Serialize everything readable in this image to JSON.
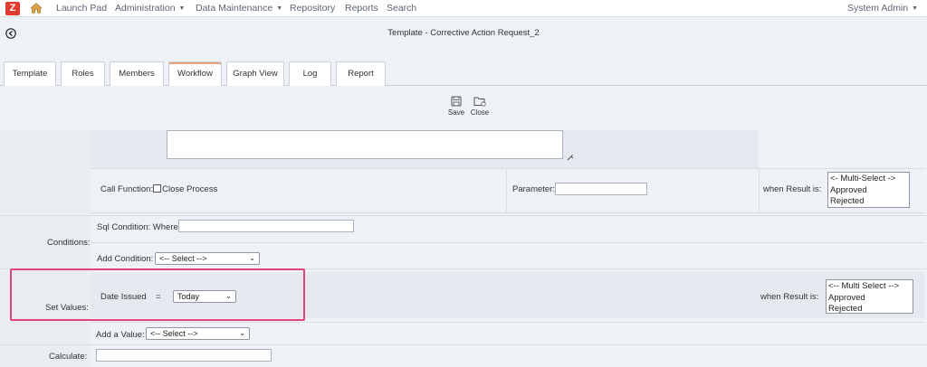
{
  "topnav": {
    "logo_letter": "Z",
    "items": [
      {
        "label": "Launch Pad"
      },
      {
        "label": "Administration",
        "has_dropdown": true
      },
      {
        "label": "Data Maintenance",
        "has_dropdown": true
      },
      {
        "label": "Repository"
      },
      {
        "label": "Reports"
      },
      {
        "label": "Search"
      }
    ],
    "user": "System Admin",
    "user_has_dropdown": true
  },
  "page": {
    "title": "Template - Corrective Action Request_2"
  },
  "tabs": [
    {
      "label": "Template",
      "active": false
    },
    {
      "label": "Roles",
      "active": false
    },
    {
      "label": "Members",
      "active": false
    },
    {
      "label": "Workflow",
      "active": true
    },
    {
      "label": "Graph View",
      "active": false
    },
    {
      "label": "Log",
      "active": false
    },
    {
      "label": "Report",
      "active": false
    }
  ],
  "toolbar": {
    "save_label": "Save",
    "close_label": "Close"
  },
  "form": {
    "call_function": {
      "label": "Call Function:",
      "checkbox_label": "Close Process",
      "checked": false,
      "parameter_label": "Parameter:",
      "parameter_value": "",
      "when_result_label": "when Result is:",
      "result_options": [
        "<- Multi-Select ->",
        "Approved",
        "Rejected"
      ]
    },
    "conditions": {
      "label": "Conditions:",
      "sql_label": "Sql Condition: Where",
      "sql_value": "",
      "add_label": "Add Condition:",
      "add_selected": "<-- Select -->"
    },
    "set_values": {
      "label": "Set Values:",
      "field": "Date Issued",
      "operator": "=",
      "value_selected": "Today",
      "when_result_label": "when Result is:",
      "result_options": [
        "<-- Multi Select -->",
        "Approved",
        "Rejected"
      ],
      "add_label": "Add a Value:",
      "add_selected": "<-- Select -->"
    },
    "calculate": {
      "label": "Calculate:",
      "value": ""
    }
  },
  "colors": {
    "logo_bg": "#e33b2f",
    "highlight_border": "#e2447a",
    "active_tab_accent": "#e8a07a"
  }
}
